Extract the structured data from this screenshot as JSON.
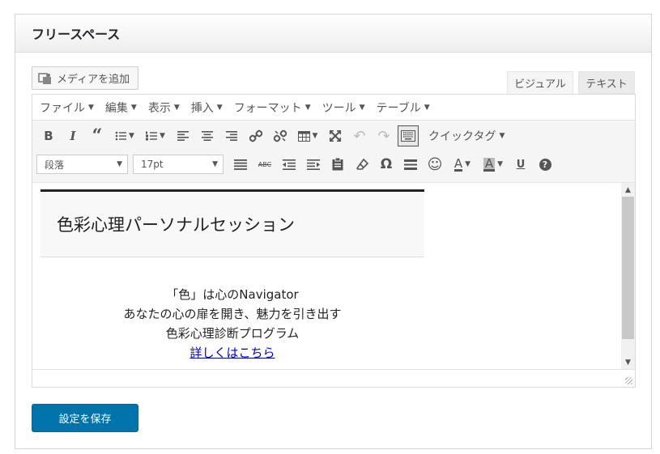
{
  "panel": {
    "title": "フリースペース"
  },
  "media_button": {
    "label": "メディアを追加"
  },
  "tabs": [
    {
      "label": "ビジュアル"
    },
    {
      "label": "テキスト"
    }
  ],
  "menubar": [
    {
      "label": "ファイル"
    },
    {
      "label": "編集"
    },
    {
      "label": "表示"
    },
    {
      "label": "挿入"
    },
    {
      "label": "フォーマット"
    },
    {
      "label": "ツール"
    },
    {
      "label": "テーブル"
    }
  ],
  "toolbar": {
    "bold": "B",
    "italic": "I",
    "quote": "“",
    "omega": "Ω",
    "text_color": "A",
    "bg_color": "A",
    "underline": "U",
    "help": "?",
    "quicktag": "クイックタグ",
    "format_select": "段落",
    "size_select": "17pt"
  },
  "content": {
    "heading": "色彩心理パーソナルセッション",
    "line1": "「色」は心のNavigator",
    "line2": "あなたの心の扉を開き、魅力を引き出す",
    "line3": "色彩心理診断プログラム",
    "link": "詳しくはこちら"
  },
  "save_button": {
    "label": "設定を保存"
  },
  "colors": {
    "primary": "#0073aa",
    "link": "#0000cc"
  }
}
